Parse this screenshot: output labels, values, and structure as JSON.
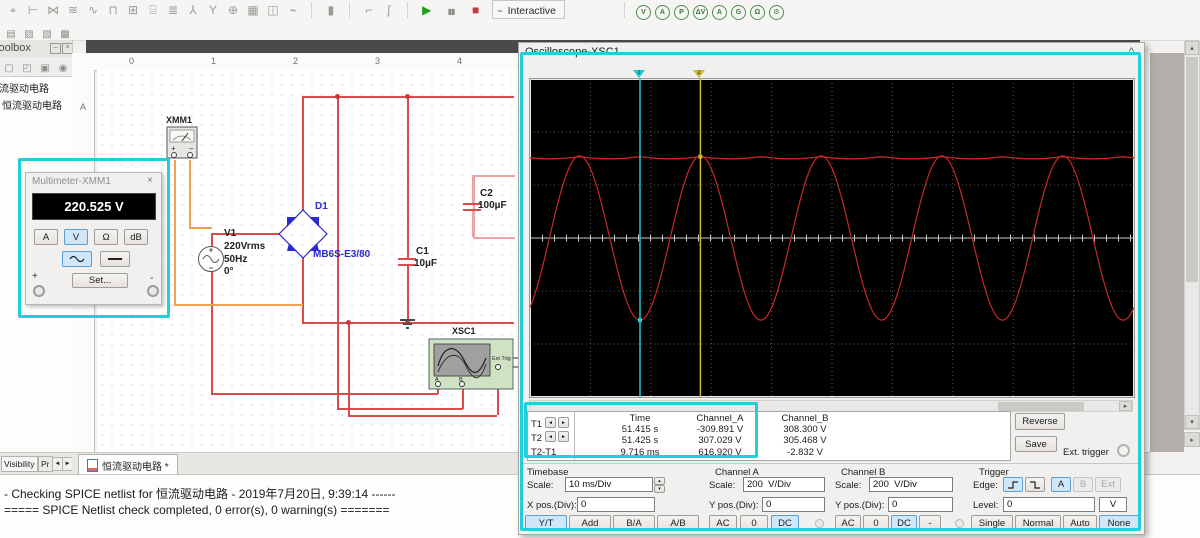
{
  "icons": {
    "close": "×",
    "collapse": "^",
    "play": "▶",
    "pause": "▮▮",
    "stop": "■",
    "interactive_glyph": "⌁",
    "left": "◄",
    "right": "►",
    "up": "▴",
    "down": "▾",
    "minimize": "–",
    "spin_up": "▴",
    "spin_down": "▾",
    "hscroll_right": "▸"
  },
  "app": {
    "toolbar": {
      "component_icons": [
        "⌖",
        "⊢",
        "⋈",
        "≋",
        "∿",
        "⊓",
        "⊞",
        "⌸",
        "≣",
        "⅄",
        "Y",
        "⊕",
        "▦",
        "◫",
        "⌁"
      ],
      "mid_icons": [
        "▮"
      ],
      "misc_icons": [
        "⌐",
        "∫"
      ],
      "row2_icons": [
        "▤",
        "▨",
        "▧",
        "▩"
      ],
      "probe_icons": [
        "V",
        "A",
        "P",
        "ΔV",
        "A",
        "G",
        "Ω",
        "⚙"
      ],
      "interactive_label": "Interactive"
    },
    "toolbox": {
      "title": "Toolbox",
      "mini_icons": [
        "▢",
        "◰",
        "▣",
        "◉"
      ],
      "items": [
        "恒流驱动电路",
        "恒流驱动电路"
      ],
      "tabs": [
        "Visibility",
        "Pr"
      ]
    },
    "ruler_numbers": [
      "0",
      "1",
      "2",
      "3",
      "4"
    ],
    "ruler_row_label": "A",
    "sheet_tab": "恒流驱动电路 *",
    "status_lines": [
      "- Checking SPICE netlist for 恒流驱动电路 - 2019年7月20日, 9:39:14 ------",
      "===== SPICE Netlist check completed, 0 error(s), 0 warning(s) ======="
    ]
  },
  "multimeter": {
    "title": "Multimeter-XMM1",
    "reading": "220.525 V",
    "modes": [
      "A",
      "V",
      "Ω",
      "dB"
    ],
    "selected_mode": "V",
    "set_label": "Set...",
    "plus": "+",
    "minus": "-"
  },
  "circuit": {
    "xmm1": {
      "ref": "XMM1"
    },
    "v1": {
      "ref": "V1",
      "value": "220Vrms",
      "freq": "50Hz",
      "phase": "0°"
    },
    "d1": {
      "ref": "D1",
      "part": "MB6S-E3/80"
    },
    "c1": {
      "ref": "C1",
      "value": "10µF"
    },
    "c2": {
      "ref": "C2",
      "value": "100µF"
    },
    "xsc1": {
      "ref": "XSC1",
      "ext": "Ext Trig",
      "a": "A",
      "b": "B"
    }
  },
  "oscilloscope": {
    "title": "Oscilloscope-XSC1",
    "table": {
      "headers": [
        "Time",
        "Channel_A",
        "Channel_B"
      ],
      "rows": [
        [
          "T1",
          "51.415 s",
          "-309.891 V",
          "308.300 V"
        ],
        [
          "T2",
          "51.425 s",
          "307.029 V",
          "305.468 V"
        ],
        [
          "T2-T1",
          "9.716 ms",
          "616.920 V",
          "-2.832 V"
        ]
      ]
    },
    "reverse_label": "Reverse",
    "save_label": "Save",
    "ext_trigger_label": "Ext. trigger",
    "timebase": {
      "title": "Timebase",
      "scale_label": "Scale:",
      "scale_value": "10 ms/Div",
      "xpos_label": "X pos.(Div):",
      "xpos_value": "0",
      "modes": [
        "Y/T",
        "Add",
        "B/A",
        "A/B"
      ],
      "active_mode": "Y/T"
    },
    "channel_a": {
      "title": "Channel A",
      "scale_label": "Scale:",
      "scale_value": "200  V/Div",
      "ypos_label": "Y pos.(Div):",
      "ypos_value": "0",
      "couplings": [
        "AC",
        "0",
        "DC"
      ],
      "active_coupling": "DC"
    },
    "channel_b": {
      "title": "Channel B",
      "scale_label": "Scale:",
      "scale_value": "200  V/Div",
      "ypos_label": "Y pos.(Div):",
      "ypos_value": "0",
      "couplings": [
        "AC",
        "0",
        "DC",
        "-"
      ],
      "active_coupling": "DC"
    },
    "trigger": {
      "title": "Trigger",
      "edge_label": "Edge:",
      "sources": [
        "A",
        "B",
        "Ext"
      ],
      "level_label": "Level:",
      "level_value": "0",
      "level_unit": "V",
      "modes": [
        "Single",
        "Normal",
        "Auto",
        "None"
      ],
      "active_mode": "None"
    }
  },
  "chart_data": {
    "type": "line",
    "title": "Oscilloscope-XSC1 display",
    "timebase": "10 ms/Div",
    "divisions": {
      "x": 10,
      "y": 6
    },
    "series": [
      {
        "name": "Channel_A",
        "waveform": "sine",
        "frequency_hz": 50,
        "amplitude_v": 310,
        "offset_v": 0,
        "volts_per_div": 200,
        "color": "#c62828"
      },
      {
        "name": "Channel_B",
        "waveform": "dc_with_ripple",
        "level_v": 307,
        "ripple_vpp": 5,
        "ripple_frequency_hz": 100,
        "volts_per_div": 200,
        "color": "#c62828"
      }
    ],
    "cursors": [
      {
        "id": "1",
        "time": "51.415 s",
        "channel_a": "-309.891 V",
        "channel_b": "308.300 V",
        "color": "#1fc9d6"
      },
      {
        "id": "2",
        "time": "51.425 s",
        "channel_a": "307.029 V",
        "channel_b": "305.468 V",
        "color": "#c9b832"
      }
    ],
    "delta": {
      "time": "9.716 ms",
      "channel_a": "616.920 V",
      "channel_b": "-2.832 V"
    }
  },
  "colors": {
    "highlight": "#1fd0da",
    "wire_red": "#d94c4c",
    "wire_orange": "#efa24f",
    "component_blue": "#2a2ad0",
    "trace_red": "#c62828",
    "active_blue": "#cfe7f8"
  }
}
